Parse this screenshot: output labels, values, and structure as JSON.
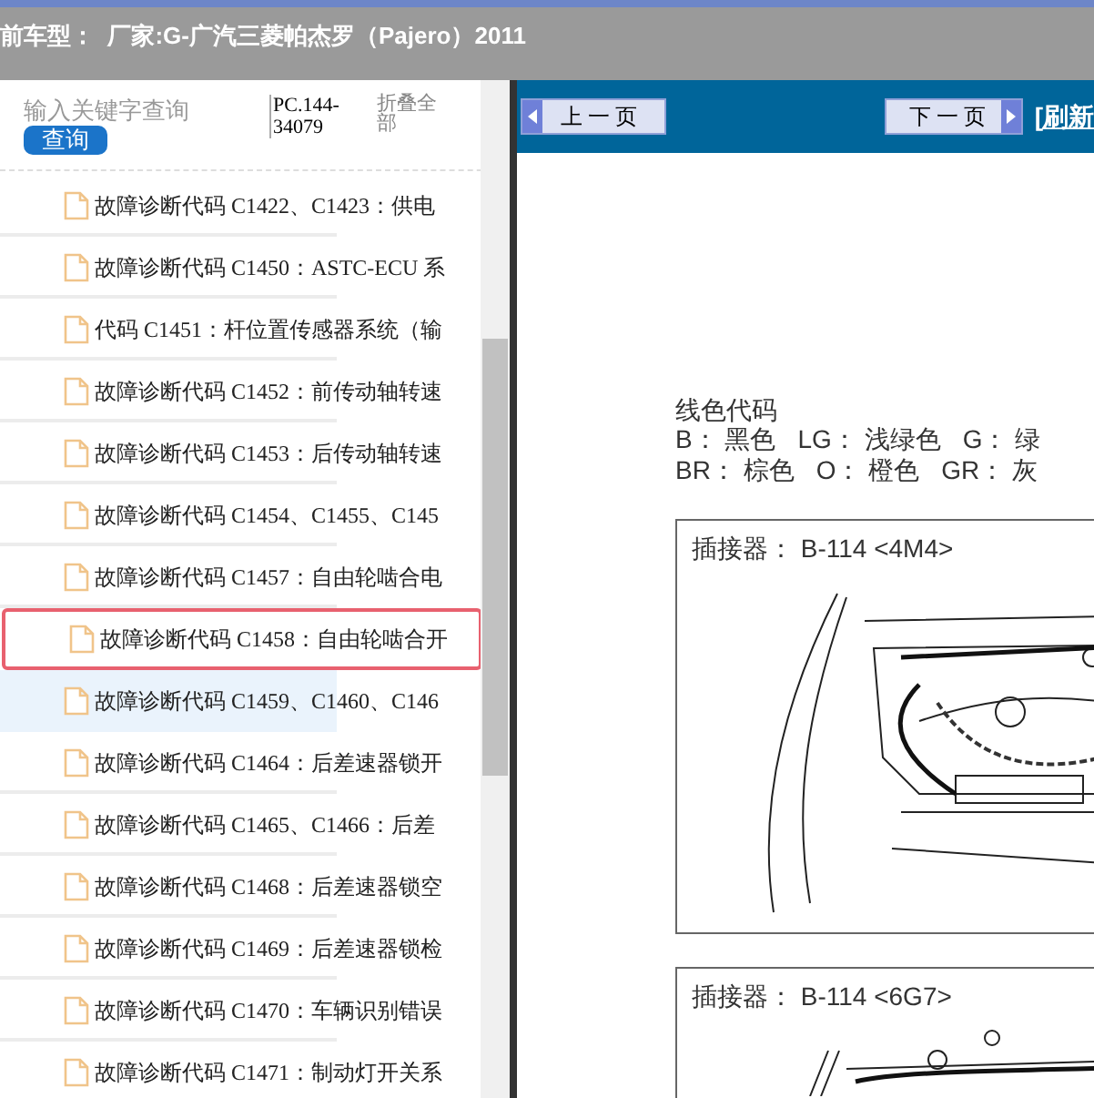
{
  "top_bar": {
    "title": "前车型：  厂家:G-广汽三菱帕杰罗（Pajero）2011"
  },
  "sidebar": {
    "search": {
      "placeholder": "输入关键字查询"
    },
    "search_button": "查询",
    "code": "PC.144-34079",
    "collapse_all": "折叠全部",
    "items": [
      {
        "label": "故障诊断代码 C1422、C1423：供电",
        "selected": false,
        "hovered": false
      },
      {
        "label": "故障诊断代码 C1450：ASTC-ECU 系",
        "selected": false,
        "hovered": false
      },
      {
        "label": "代码 C1451：杆位置传感器系统（输",
        "selected": false,
        "hovered": false
      },
      {
        "label": "故障诊断代码 C1452：前传动轴转速",
        "selected": false,
        "hovered": false
      },
      {
        "label": "故障诊断代码 C1453：后传动轴转速",
        "selected": false,
        "hovered": false
      },
      {
        "label": "故障诊断代码 C1454、C1455、C145",
        "selected": false,
        "hovered": false
      },
      {
        "label": "故障诊断代码 C1457：自由轮啮合电",
        "selected": false,
        "hovered": false
      },
      {
        "label": "故障诊断代码 C1458：自由轮啮合开",
        "selected": true,
        "hovered": false
      },
      {
        "label": "故障诊断代码 C1459、C1460、C146",
        "selected": false,
        "hovered": true
      },
      {
        "label": "故障诊断代码 C1464：后差速器锁开",
        "selected": false,
        "hovered": false
      },
      {
        "label": "故障诊断代码 C1465、C1466：后差",
        "selected": false,
        "hovered": false
      },
      {
        "label": "故障诊断代码 C1468：后差速器锁空",
        "selected": false,
        "hovered": false
      },
      {
        "label": "故障诊断代码 C1469：后差速器锁检",
        "selected": false,
        "hovered": false
      },
      {
        "label": "故障诊断代码 C1470：车辆识别错误",
        "selected": false,
        "hovered": false
      },
      {
        "label": "故障诊断代码 C1471：制动灯开关系",
        "selected": false,
        "hovered": false
      }
    ]
  },
  "viewer": {
    "prev_button": "上一页",
    "next_button": "下一页",
    "refresh_link": "[刷新",
    "document": {
      "heading": "线色代码",
      "color_lines": [
        [
          {
            "code": "B：",
            "name": "黑色"
          },
          {
            "code": "LG：",
            "name": "浅绿色"
          },
          {
            "code": "G：",
            "name": "绿"
          }
        ],
        [
          {
            "code": "BR：",
            "name": "棕色"
          },
          {
            "code": "O：",
            "name": "橙色"
          },
          {
            "code": "GR：",
            "name": "灰"
          }
        ]
      ],
      "connectors": [
        {
          "label": "插接器：",
          "id": "B-114 <4M4>"
        },
        {
          "label": "插接器：",
          "id": "B-114 <6G7>"
        }
      ]
    }
  }
}
